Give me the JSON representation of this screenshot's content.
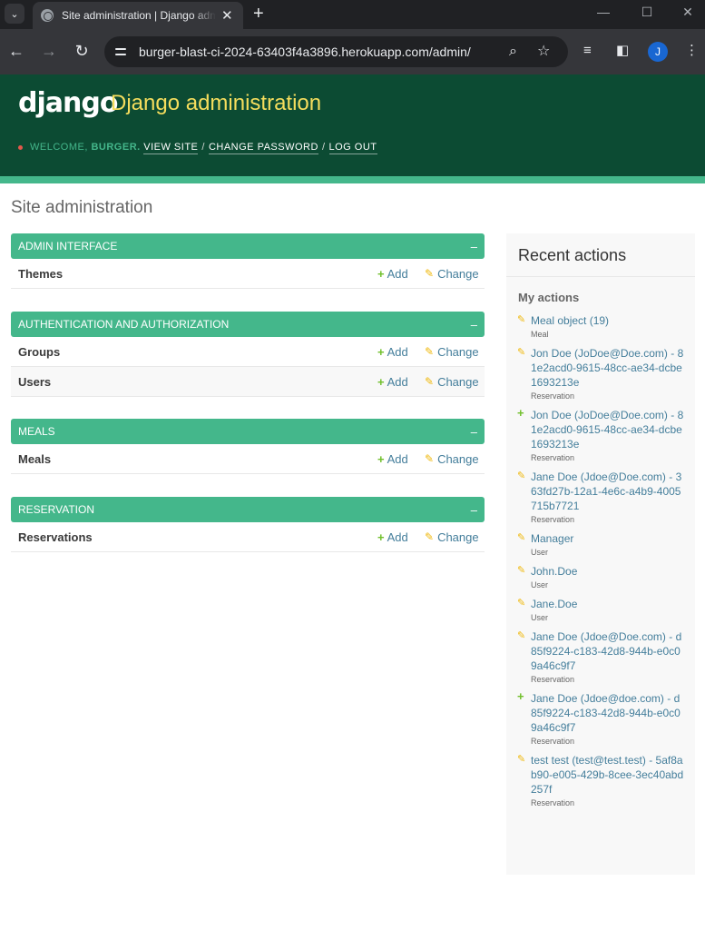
{
  "browser": {
    "tab_title": "Site administration | Django admin",
    "url": "burger-blast-ci-2024-63403f4a3896.herokuapp.com/admin/",
    "profile_initial": "J"
  },
  "header": {
    "logo": "django",
    "site_title": "Django administration",
    "welcome": "Welcome,",
    "username": "burger.",
    "view_site": "View site",
    "change_password": "Change password",
    "log_out": "Log out"
  },
  "page": {
    "title": "Site administration"
  },
  "apps": [
    {
      "caption": "Admin Interface",
      "models": [
        {
          "name": "Themes"
        }
      ]
    },
    {
      "caption": "Authentication and Authorization",
      "models": [
        {
          "name": "Groups"
        },
        {
          "name": "Users"
        }
      ]
    },
    {
      "caption": "Meals",
      "models": [
        {
          "name": "Meals"
        }
      ]
    },
    {
      "caption": "Reservation",
      "models": [
        {
          "name": "Reservations"
        }
      ]
    }
  ],
  "links": {
    "add": "Add",
    "change": "Change"
  },
  "recent_actions": {
    "title": "Recent actions",
    "subtitle": "My actions",
    "items": [
      {
        "action": "edit",
        "object": "Meal object (19)",
        "type": "Meal"
      },
      {
        "action": "edit",
        "object": "Jon Doe (JoDoe@Doe.com) - 81e2acd0-9615-48cc-ae34-dcbe1693213e",
        "type": "Reservation"
      },
      {
        "action": "add",
        "object": "Jon Doe (JoDoe@Doe.com) - 81e2acd0-9615-48cc-ae34-dcbe1693213e",
        "type": "Reservation"
      },
      {
        "action": "edit",
        "object": "Jane Doe (Jdoe@Doe.com) - 363fd27b-12a1-4e6c-a4b9-4005715b7721",
        "type": "Reservation"
      },
      {
        "action": "edit",
        "object": "Manager",
        "type": "User"
      },
      {
        "action": "edit",
        "object": "John.Doe",
        "type": "User"
      },
      {
        "action": "edit",
        "object": "Jane.Doe",
        "type": "User"
      },
      {
        "action": "edit",
        "object": "Jane Doe (Jdoe@Doe.com) - d85f9224-c183-42d8-944b-e0c09a46c9f7",
        "type": "Reservation"
      },
      {
        "action": "add",
        "object": "Jane Doe (Jdoe@doe.com) - d85f9224-c183-42d8-944b-e0c09a46c9f7",
        "type": "Reservation"
      },
      {
        "action": "edit",
        "object": "test test (test@test.test) - 5af8ab90-e005-429b-8cee-3ec40abd257f",
        "type": "Reservation"
      }
    ]
  }
}
